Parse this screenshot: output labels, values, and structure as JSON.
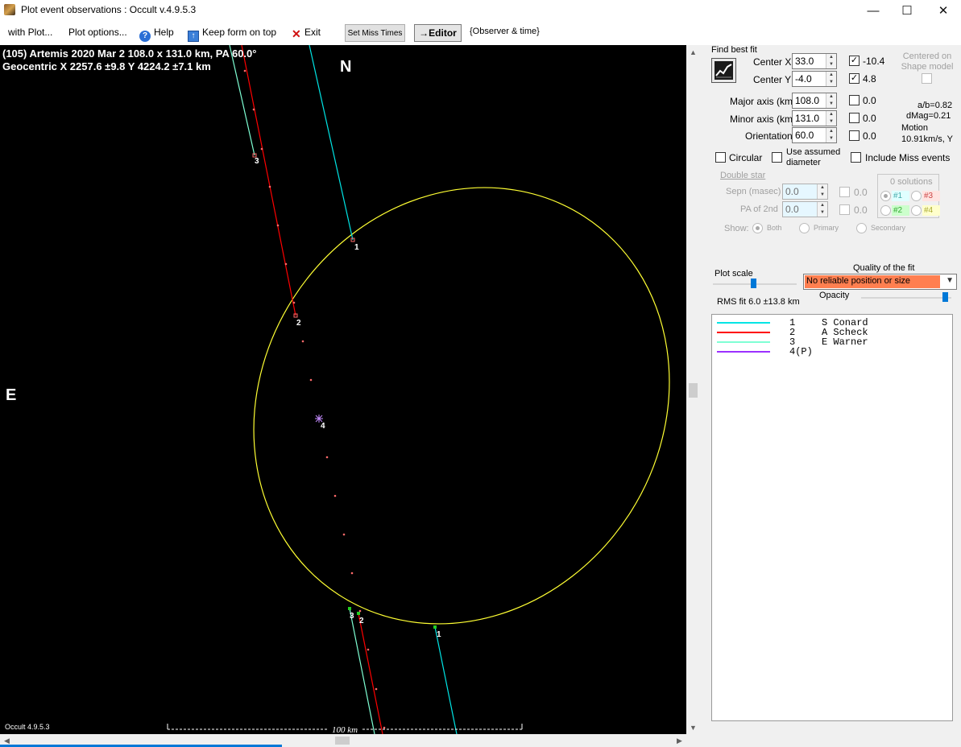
{
  "window": {
    "title": "Plot event observations : Occult v.4.9.5.3",
    "minimize": "—",
    "maximize": "☐",
    "close": "✕"
  },
  "menu": {
    "with_plot": "with Plot...",
    "plot_options": "Plot options...",
    "help": "Help",
    "keep_on_top": "Keep form on top",
    "exit": "Exit",
    "set_miss_times": "Set Miss Times",
    "editor": "→Editor",
    "observer_time": "{Observer & time}"
  },
  "plot": {
    "info_line1": "(105) Artemis  2020 Mar 2   108.0 x 131.0 km, PA 60.0°",
    "info_line2": "Geocentric  X  2257.6 ±9.8  Y 4224.2 ±7.1 km",
    "north": "N",
    "east": "E",
    "version": "Occult 4.9.5.3",
    "scale_label": "100 km",
    "colors": {
      "ellipse": "#ffff33",
      "chord_1": "#00e5e5",
      "chord_2": "#ff0000",
      "chord_3": "#7fffd4",
      "chord_4": "#9b30ff",
      "path_dots": "#ff6b6b"
    },
    "chord_labels": [
      "1",
      "2",
      "3",
      "1",
      "2",
      "3",
      "4"
    ]
  },
  "panel": {
    "find_best_fit": "Find best fit",
    "center_x_label": "Center X",
    "center_x": "33.0",
    "center_x_fit": "-10.4",
    "center_y_label": "Center Y",
    "center_y": "-4.0",
    "center_y_fit": "4.8",
    "centered_shape": "Centered on Shape model",
    "major_label": "Major axis (km)",
    "major": "108.0",
    "major_fit": "0.0",
    "minor_label": "Minor axis (km)",
    "minor": "131.0",
    "minor_fit": "0.0",
    "orient_label": "Orientation",
    "orient": "60.0",
    "orient_fit": "0.0",
    "ab_ratio": "a/b=0.82",
    "dmag": "dMag=0.21",
    "motion_label": "Motion",
    "motion": "10.91km/s, Y",
    "circular": "Circular",
    "use_assumed": "Use assumed diameter",
    "include_miss": "Include Miss events",
    "double_star": "Double star",
    "sepn_label": "Sepn (masec)",
    "sepn": "0.0",
    "sepn_fit": "0.0",
    "pa2_label": "PA of 2nd",
    "pa2": "0.0",
    "pa2_fit": "0.0",
    "show_label": "Show:",
    "show_both": "Both",
    "show_primary": "Primary",
    "show_secondary": "Secondary",
    "solutions": "0 solutions",
    "sol1": "#1",
    "sol2": "#2",
    "sol3": "#3",
    "sol4": "#4",
    "plot_scale": "Plot scale",
    "quality_label": "Quality of the fit",
    "quality_value": "No reliable position or size",
    "opacity": "Opacity",
    "rms": "RMS fit 6.0 ±13.8 km",
    "legend": [
      {
        "num": "1",
        "name": "S Conard",
        "color": "#00e5e5"
      },
      {
        "num": "2",
        "name": "A Scheck",
        "color": "#ff0000"
      },
      {
        "num": "3",
        "name": "E Warner",
        "color": "#7fffd4"
      },
      {
        "num": "4(P)",
        "name": "",
        "color": "#9b30ff"
      }
    ]
  }
}
